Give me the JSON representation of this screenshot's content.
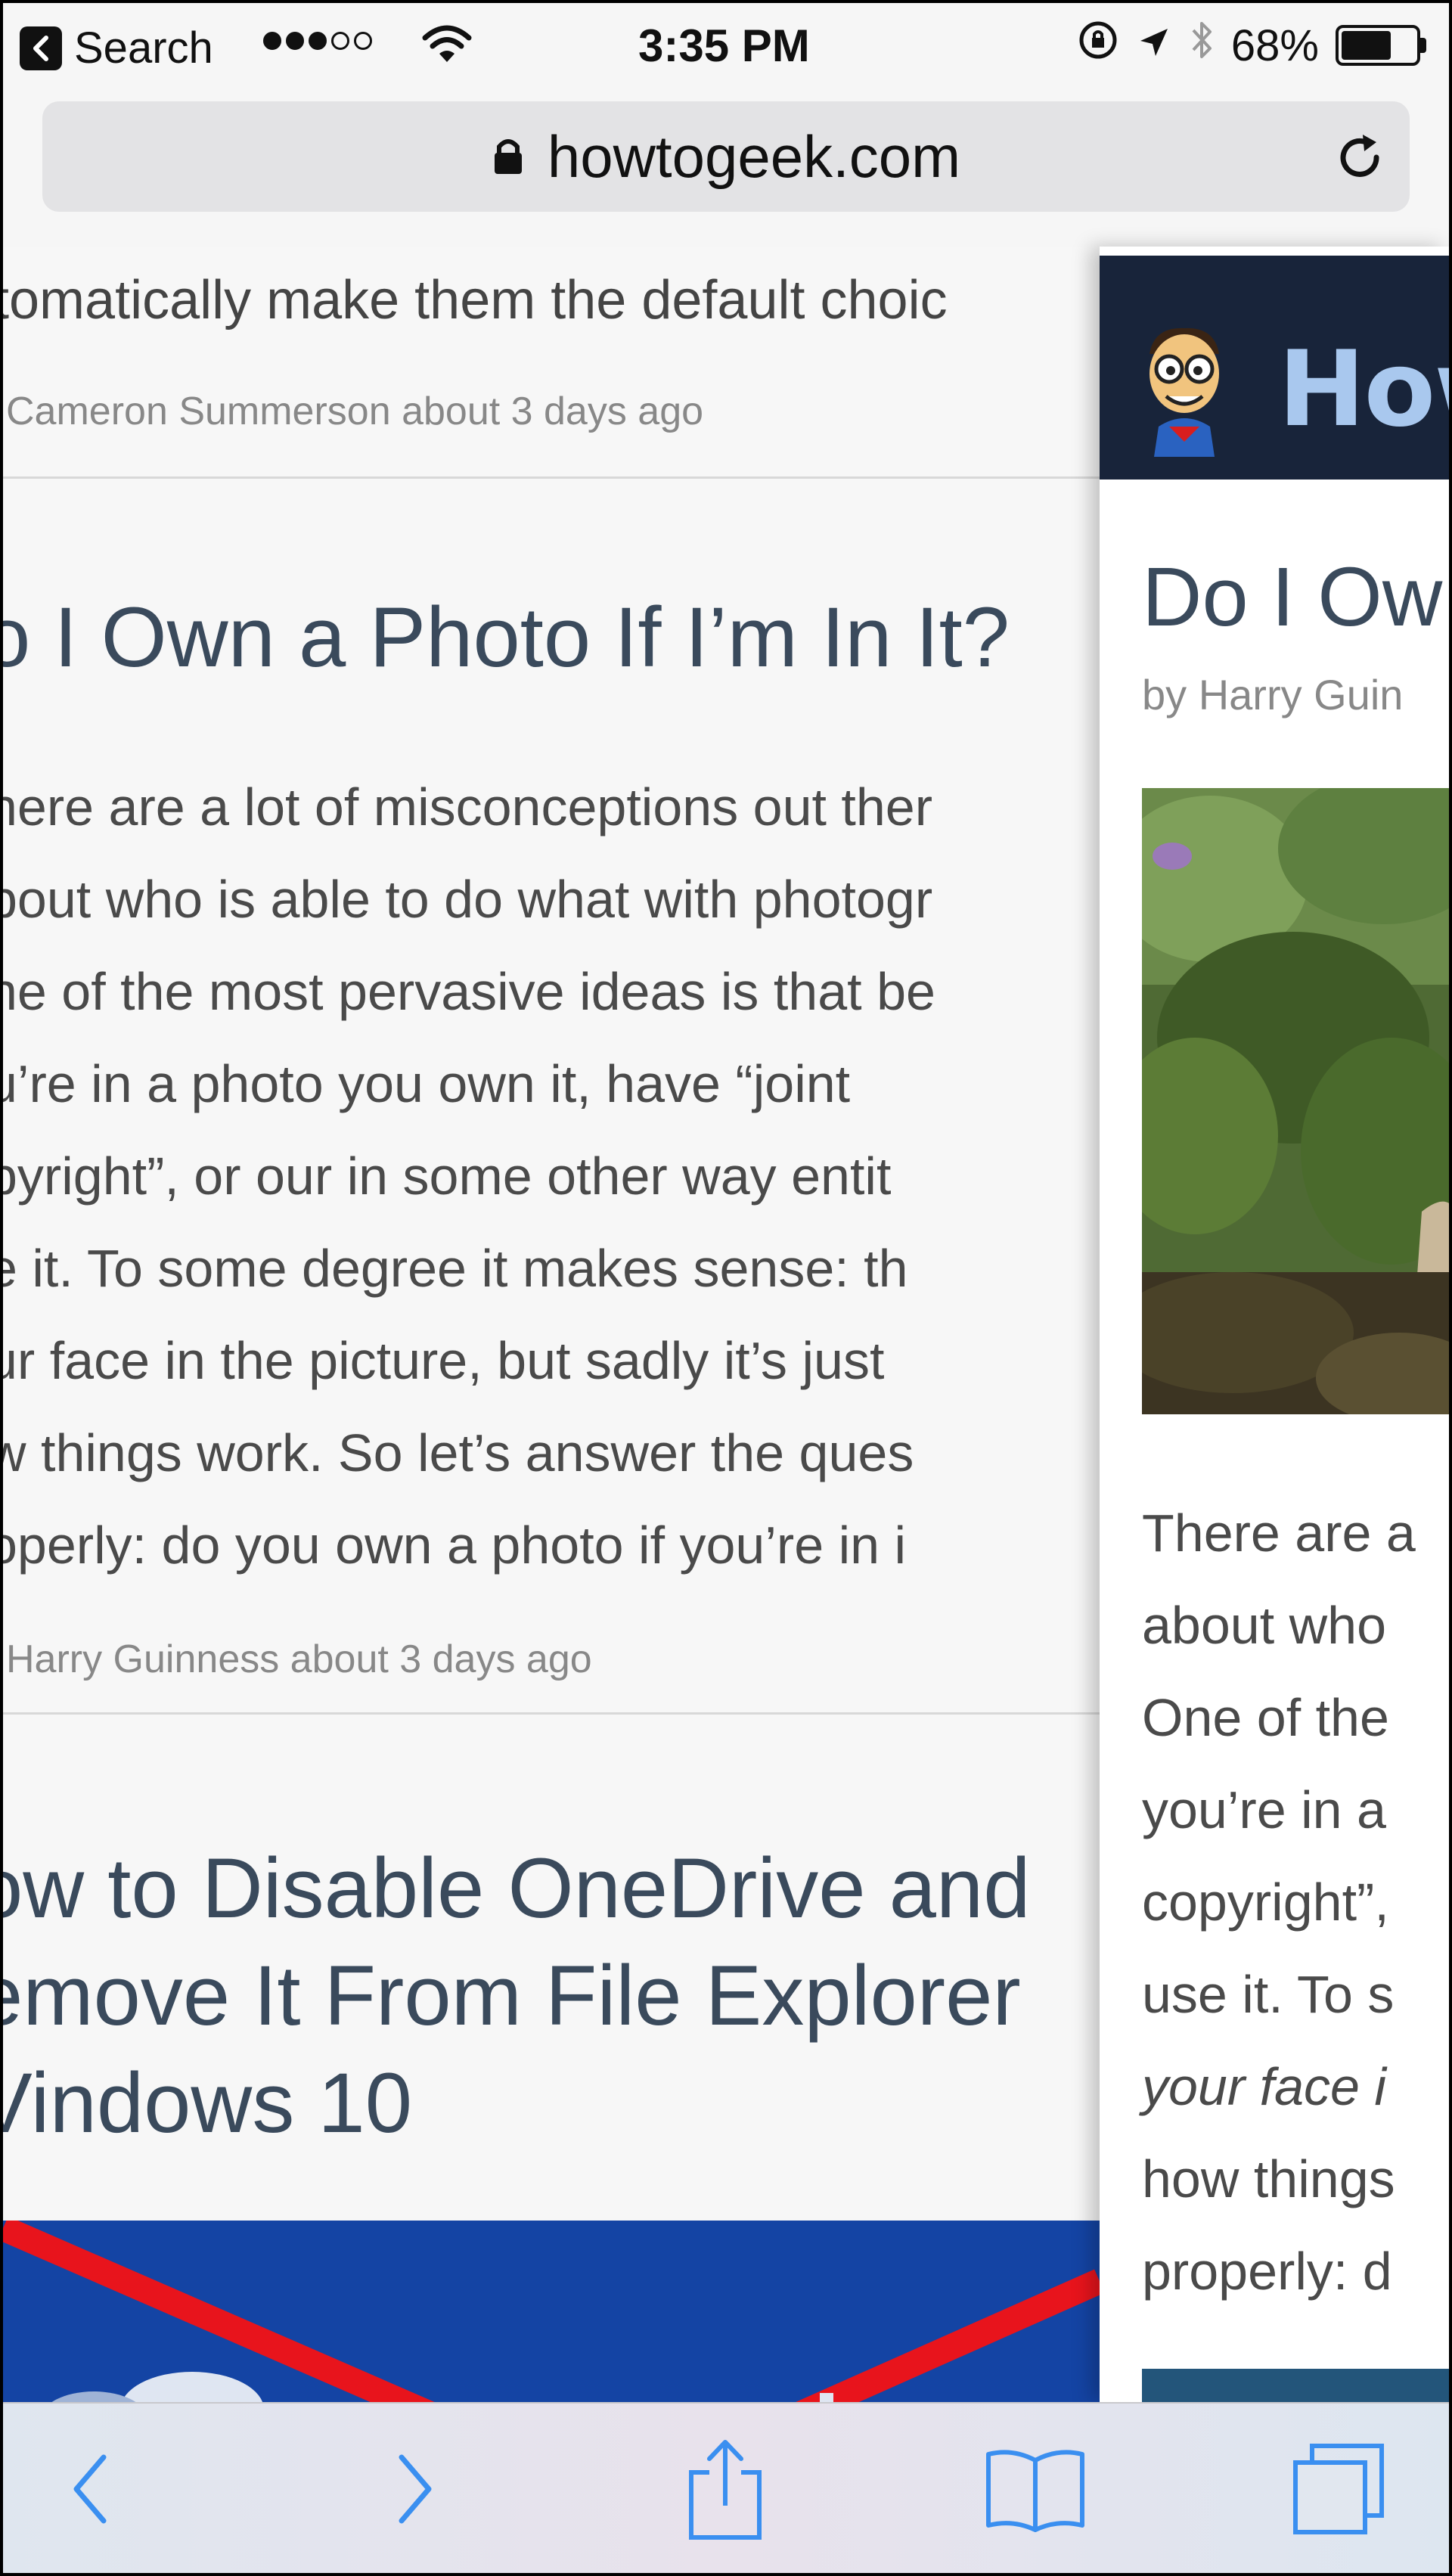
{
  "status_bar": {
    "back_app_label": "Search",
    "time": "3:35 PM",
    "battery_percent": "68%",
    "battery_level": 0.68,
    "signal_bars_filled": 3,
    "signal_bars_total": 5
  },
  "address_bar": {
    "url": "howtogeek.com"
  },
  "left_page": {
    "excerpt_top": "tomatically make them the default choic",
    "byline_1": "Cameron Summerson about 3 days ago",
    "headline_1": "o I Own a Photo If I’m In It?",
    "body_lines": [
      "here are a lot of misconceptions out ther",
      "bout who is able to do what with photogr",
      "ne of the most pervasive ideas is that be",
      "u’re in a photo you own it, have “joint",
      "pyright”, or our in some other way entit",
      "e it. To some degree it makes sense: th",
      "ur face in the picture, but sadly it’s just",
      "w things work. So let’s answer the ques",
      "operly: do you own a photo if you’re in i"
    ],
    "byline_2": "Harry Guinness about 3 days ago",
    "headline_2_lines": [
      "ow to Disable OneDrive and",
      "emove It From File Explorer",
      "Vindows 10"
    ]
  },
  "right_page": {
    "logo_text": "How-",
    "title": "Do I Ow",
    "byline": "by Harry Guin",
    "body_lines": [
      "There are a",
      "about who",
      "One of the",
      "you’re in a",
      "copyright”,",
      "use it. To s",
      "your face i",
      "how things",
      "properly: d"
    ]
  },
  "toolbar": {
    "icons": [
      "back-icon",
      "forward-icon",
      "share-icon",
      "bookmarks-icon",
      "tabs-icon"
    ]
  },
  "colors": {
    "tint": "#3a8ff0",
    "headline": "#3a4a5c",
    "logo_bg": "#18243a",
    "logo_text": "#a9c8ee"
  }
}
